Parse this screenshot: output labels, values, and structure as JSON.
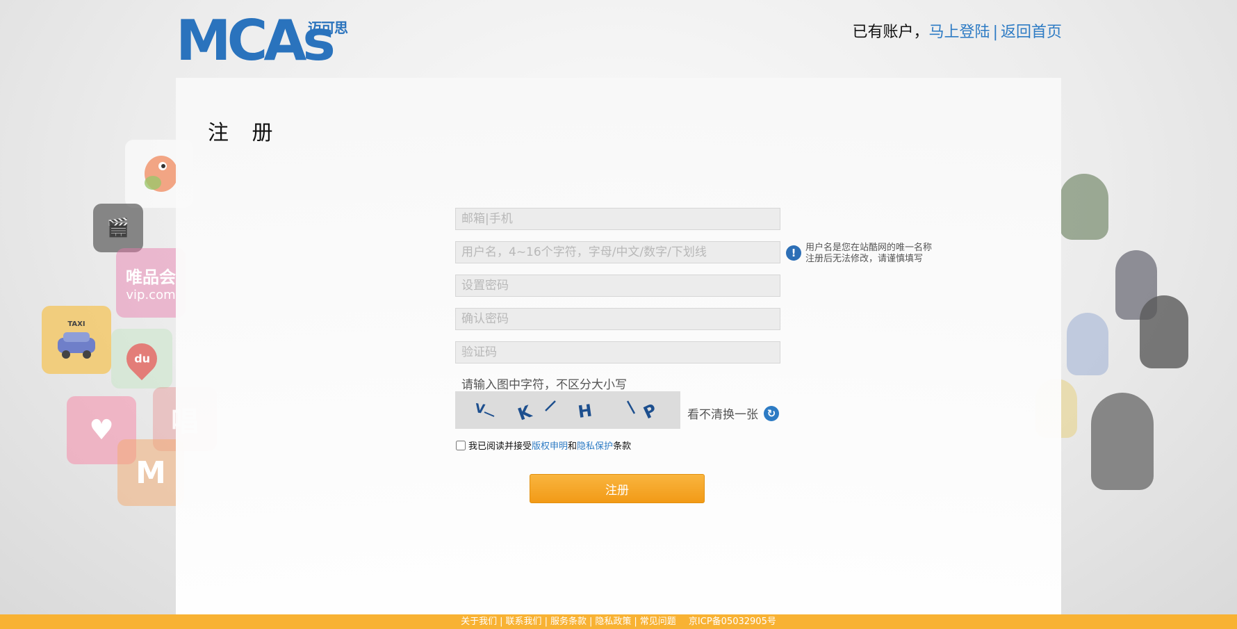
{
  "logo": {
    "main": "MCAs",
    "cn": "迈可思"
  },
  "top_links": {
    "prefix": "已有账户，",
    "login": "马上登陆",
    "separator": "|",
    "home": "返回首页"
  },
  "form": {
    "title": "注 册",
    "email_placeholder": "邮箱|手机",
    "username_placeholder": "用户名，4~16个字符，字母/中文/数字/下划线",
    "password_placeholder": "设置密码",
    "confirm_placeholder": "确认密码",
    "captcha_placeholder": "验证码",
    "hint_line1": "用户名是您在站酷网的唯一名称",
    "hint_line2": "注册后无法修改，请谨慎填写",
    "captcha_tip": "请输入图中字符，不区分大小写",
    "captcha_chars": [
      "V",
      "K",
      "H",
      "P"
    ],
    "refresh_label": "看不清换一张",
    "agree_prefix": "我已阅读并接受",
    "agree_link1": "版权申明",
    "agree_and": "和",
    "agree_link2": "隐私保护",
    "agree_suffix": "条款",
    "submit_label": "注册"
  },
  "deco": {
    "vip_text": "唯品会",
    "vip_sub": "vip.com",
    "taxi_text": "TAXI",
    "du_text": "du"
  },
  "footer": {
    "links": [
      "关于我们",
      "联系我们",
      "服务条款",
      "隐私政策",
      "常见问题"
    ],
    "icp": "京ICP备05032905号"
  }
}
